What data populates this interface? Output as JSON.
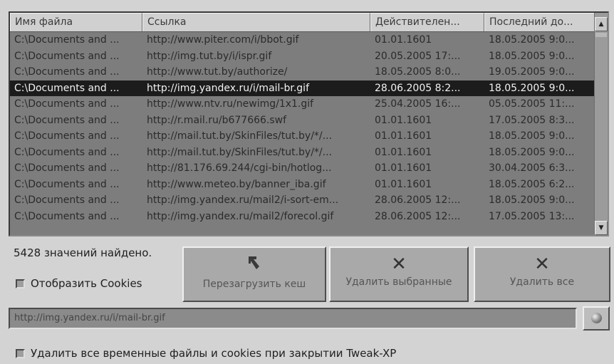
{
  "table": {
    "columns": [
      "Имя файла",
      "Ссылка",
      "Действителен...",
      "Последний до..."
    ],
    "rows": [
      [
        "C:\\Documents and ...",
        "http://www.piter.com/i/bbot.gif",
        "01.01.1601",
        "18.05.2005 9:0..."
      ],
      [
        "C:\\Documents and ...",
        "http://img.tut.by/i/ispr.gif",
        "20.05.2005 17:...",
        "18.05.2005 9:0..."
      ],
      [
        "C:\\Documents and ...",
        "http://www.tut.by/authorize/",
        "18.05.2005 8:0...",
        "19.05.2005 9:0..."
      ],
      [
        "C:\\Documents and ...",
        "http://img.yandex.ru/i/mail-br.gif",
        "28.06.2005 8:2...",
        "18.05.2005 9:0..."
      ],
      [
        "C:\\Documents and ...",
        "http://www.ntv.ru/newimg/1x1.gif",
        "25.04.2005 16:...",
        "05.05.2005 11:..."
      ],
      [
        "C:\\Documents and ...",
        "http://r.mail.ru/b677666.swf",
        "01.01.1601",
        "17.05.2005 8:3..."
      ],
      [
        "C:\\Documents and ...",
        "http://mail.tut.by/SkinFiles/tut.by/*/...",
        "01.01.1601",
        "18.05.2005 9:0..."
      ],
      [
        "C:\\Documents and ...",
        "http://mail.tut.by/SkinFiles/tut.by/*/...",
        "01.01.1601",
        "18.05.2005 9:0..."
      ],
      [
        "C:\\Documents and ...",
        "http://81.176.69.244/cgi-bin/hotlog...",
        "01.01.1601",
        "30.04.2005 6:3..."
      ],
      [
        "C:\\Documents and ...",
        "http://www.meteo.by/banner_iba.gif",
        "01.01.1601",
        "18.05.2005 6:2..."
      ],
      [
        "C:\\Documents and ...",
        "http://img.yandex.ru/mail2/i-sort-em...",
        "28.06.2005 12:...",
        "18.05.2005 9:0..."
      ],
      [
        "C:\\Documents and ...",
        "http://img.yandex.ru/mail2/forecol.gif",
        "28.06.2005 12:...",
        "17.05.2005 13:..."
      ]
    ],
    "selected_row": 3
  },
  "status": {
    "found_text": "5428 значений найдено."
  },
  "options": {
    "show_cookies_label": "Отобразить Cookies",
    "show_cookies_checked": false,
    "delete_on_close_label": "Удалить все временные файлы и cookies при закрытии Tweak-XP",
    "delete_on_close_checked": false
  },
  "buttons": {
    "reload_label": "Перезагрузить кеш",
    "reload_icon": "reload-icon",
    "delete_selected_label": "Удалить выбранные",
    "delete_selected_icon": "x-icon",
    "delete_all_label": "Удалить все",
    "delete_all_icon": "x-icon"
  },
  "url_field": {
    "value": "http://img.yandex.ru/i/mail-br.gif"
  },
  "go_button": {
    "icon": "globe-icon"
  }
}
